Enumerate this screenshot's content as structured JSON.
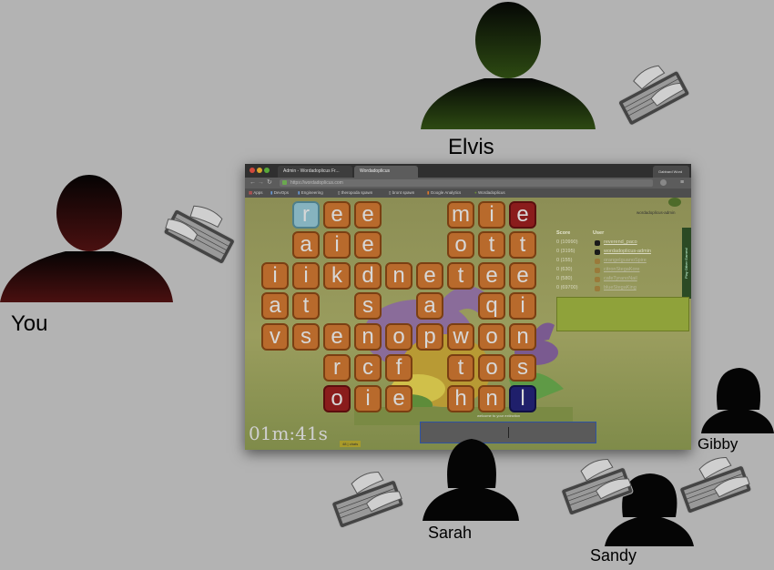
{
  "people": {
    "elvis": {
      "label": "Elvis"
    },
    "you": {
      "label": "You"
    },
    "sarah": {
      "label": "Sarah"
    },
    "sandy": {
      "label": "Sandy"
    },
    "gibby": {
      "label": "Gibby"
    }
  },
  "browser": {
    "tabs": [
      "Admin - Wordadoplicus Fr...",
      "Wordadoplicus"
    ],
    "profile_button": "Gabbard Word",
    "url": "https://wordadoplicus.com",
    "bookmarks": [
      "Apps",
      "DevOps",
      "Engineering",
      "theropoda spawn",
      "bront spawn",
      "Google Analytics",
      "Wordadoplicus"
    ]
  },
  "game": {
    "logo_text": "wordadoplicus-admin",
    "rows": [
      [
        "r",
        "e",
        "e",
        "",
        "",
        "m",
        "i",
        "e"
      ],
      [
        "a",
        "i",
        "e",
        "",
        "",
        "o",
        "t",
        "t"
      ],
      [
        "i",
        "i",
        "k",
        "d",
        "n",
        "e",
        "t",
        "e",
        "e"
      ],
      [
        "a",
        "t",
        "",
        "s",
        "",
        "a",
        "",
        "q",
        "i"
      ],
      [
        "v",
        "s",
        "e",
        "n",
        "o",
        "p",
        "w",
        "o",
        "n"
      ],
      [
        "",
        "r",
        "c",
        "f",
        "",
        "t",
        "o",
        "s"
      ],
      [
        "",
        "o",
        "i",
        "e",
        "",
        "h",
        "n",
        "l"
      ]
    ],
    "timer": "01m:41s",
    "chat_badge": "48 | chats",
    "welcome_text": "welcome to your extinction",
    "side_tab": "Play Other Games!",
    "scoreboard": {
      "score_header": "Score",
      "user_header": "User",
      "entries": [
        {
          "score": "0 (10990)",
          "user": "reverend_paco"
        },
        {
          "score": "0 (3195)",
          "user": "wordadoplicus-admin"
        },
        {
          "score": "0 (155)",
          "user": "orangeIguanoSpire"
        },
        {
          "score": "0 (630)",
          "user": "citronStegaKore"
        },
        {
          "score": "0 (580)",
          "user": "cafeTyranoNail"
        },
        {
          "score": "0 (69700)",
          "user": "blueStegaKing"
        }
      ]
    }
  },
  "colors": {
    "background": "#b3b3b3",
    "tile": "#b86a2c",
    "tile_cyan": "#86b3bf",
    "tile_red": "#8a1c1c",
    "tile_blue": "#1f1f6b"
  }
}
